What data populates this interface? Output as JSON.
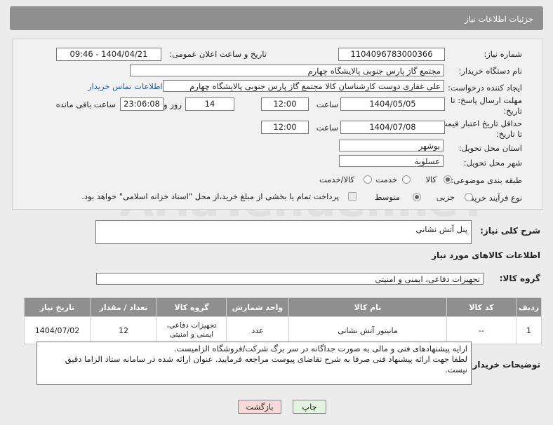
{
  "header": {
    "title": "جزئیات اطلاعات نیاز"
  },
  "fields": {
    "need_number_label": "شماره نیاز:",
    "need_number": "1104096783000366",
    "announce_label": "تاریخ و ساعت اعلان عمومی:",
    "announce_value": "1404/04/21 - 09:46",
    "buyer_org_label": "نام دستگاه خریدار:",
    "buyer_org": "مجتمع گاز پارس جنوبی  پالایشگاه چهارم",
    "creator_label": "ایجاد کننده درخواست:",
    "creator": "علی غفاری دوست کارشناسان کالا مجتمع گاز پارس جنوبی  پالایشگاه چهارم",
    "buyer_contact_link": "اطلاعات تماس خریدار",
    "reply_deadline_label_1": "مهلت ارسال پاسخ: تا",
    "reply_deadline_label_2": "تاریخ:",
    "reply_date": "1404/05/05",
    "time_label": "ساعت",
    "reply_time": "12:00",
    "reply_days": "14",
    "days_label": "روز و",
    "remaining_time": "23:06:08",
    "remaining_label": "ساعت باقی مانده",
    "price_deadline_label_1": "حداقل تاریخ اعتبار قیمت:",
    "price_deadline_label_2": "تا تاریخ:",
    "price_date": "1404/07/08",
    "price_time": "12:00",
    "province_label": "استان محل تحویل:",
    "province": "بوشهر",
    "city_label": "شهر محل تحویل:",
    "city": "عسلویه",
    "category_label": "طبقه بندی موضوعی:",
    "category_options": [
      "کالا",
      "خدمت",
      "کالا/خدمت"
    ],
    "process_label": "نوع فرآیند خرید :",
    "process_options": [
      "جزیی",
      "متوسط"
    ],
    "payment_note": "پرداخت تمام یا بخشی از مبلغ خرید،از محل \"اسناد خزانه اسلامی\" خواهد بود."
  },
  "description": {
    "label": "شرح کلی نیاز:",
    "value": "پنل آتش نشانی"
  },
  "goods": {
    "section_title": "اطلاعات کالاهای مورد نیاز",
    "group_label": "گروه کالا:",
    "group_value": "تجهیزات دفاعی، ایمنی و امنیتی",
    "columns": [
      "ردیف",
      "کد کالا",
      "نام کالا",
      "واحد شمارش",
      "گروه کالا",
      "تعداد / مقدار",
      "تاریخ نیاز"
    ],
    "rows": [
      [
        "1",
        "--",
        "مانیتور آتش نشانی",
        "عدد",
        "تجهیزات دفاعی، ایمنی و امنیتی",
        "12",
        "1404/07/02"
      ]
    ]
  },
  "buyer_notes": {
    "label": "توضیحات خریدار:",
    "line1": "ارایه پیشنهادهای فنی و مالی به صورت جداگانه در سر برگ شرکت/فروشگاه الزامیست.",
    "line2": "لطفا جهت ارائه پیشنهاد فنی صرفا به شرح تقاضای پیوست مراجعه فرمایید. عنوان ارائه شده در سامانه ستاد الزاما دقیق",
    "line3": "نیست."
  },
  "buttons": {
    "print": "چاپ",
    "back": "بازگشت"
  },
  "watermark": "AriaTender.neT",
  "colors": {
    "header_bg": "#8f8f8f",
    "link": "#1a5fb4",
    "back_btn_bg": "#f6d9d9",
    "print_btn_bg": "#e3f3df"
  }
}
